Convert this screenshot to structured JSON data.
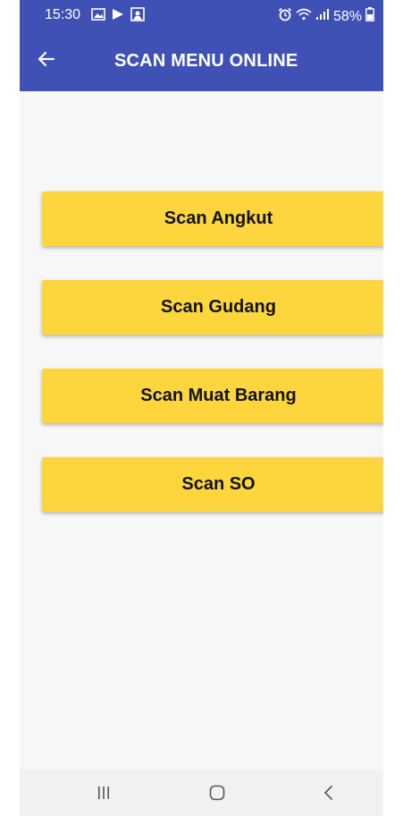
{
  "status_bar": {
    "time": "15:30",
    "battery": "58%",
    "left_icons": [
      "gallery-icon",
      "play-icon",
      "photo-icon"
    ],
    "right_icons": [
      "alarm-icon",
      "wifi-icon",
      "signal-icon",
      "battery-icon"
    ]
  },
  "app_bar": {
    "title": "SCAN MENU ONLINE",
    "back_icon": "arrow-left-icon"
  },
  "menu": {
    "items": [
      {
        "label": "Scan Angkut"
      },
      {
        "label": "Scan Gudang"
      },
      {
        "label": "Scan Muat Barang"
      },
      {
        "label": "Scan SO"
      }
    ]
  },
  "nav_bar": {
    "icons": [
      "recent-apps-icon",
      "home-icon",
      "back-icon"
    ]
  },
  "colors": {
    "primary": "#3f51b5",
    "button": "#fdd63e",
    "background": "#f7f7f7",
    "nav_bar": "#f1f1f1"
  }
}
